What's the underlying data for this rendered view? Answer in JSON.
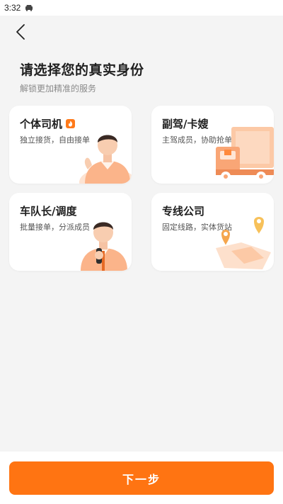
{
  "status_bar": {
    "time": "3:32"
  },
  "header": {
    "title": "请选择您的真实身份",
    "subtitle": "解锁更加精准的服务"
  },
  "roles": [
    {
      "title": "个体司机",
      "desc": "独立接货，自由接单",
      "hot_icon": "fire-icon"
    },
    {
      "title": "副驾/卡嫂",
      "desc": "主驾成员，协助抢单"
    },
    {
      "title": "车队长/调度",
      "desc": "批量接单，分派成员"
    },
    {
      "title": "专线公司",
      "desc": "固定线路，实体货站"
    }
  ],
  "footer": {
    "next_label": "下一步"
  },
  "colors": {
    "accent": "#ff7412",
    "background": "#f4f4f4"
  }
}
